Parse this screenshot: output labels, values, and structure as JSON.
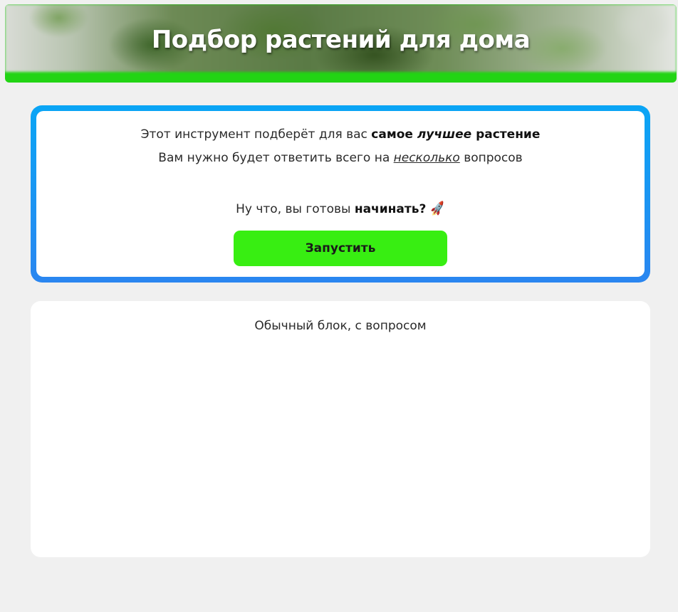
{
  "header": {
    "title": "Подбор растений для дома",
    "accent_color": "#22d414"
  },
  "intro": {
    "line1_prefix": "Этот инструмент подберёт для вас ",
    "line1_bold1": "самое ",
    "line1_bold_italic": "лучшее",
    "line1_bold2": " растение",
    "line2_prefix": "Вам нужно будет ответить всего на ",
    "line2_underlined": "несколько",
    "line2_suffix": " вопросов",
    "line3_prefix": "Ну что, вы готовы ",
    "line3_bold": "начинать?",
    "rocket_icon": "🚀",
    "border_color": "#0aa5f5"
  },
  "start_button": {
    "label": "Запустить",
    "color": "#38ee12"
  },
  "question_card": {
    "text": "Обычный блок, с вопросом"
  }
}
